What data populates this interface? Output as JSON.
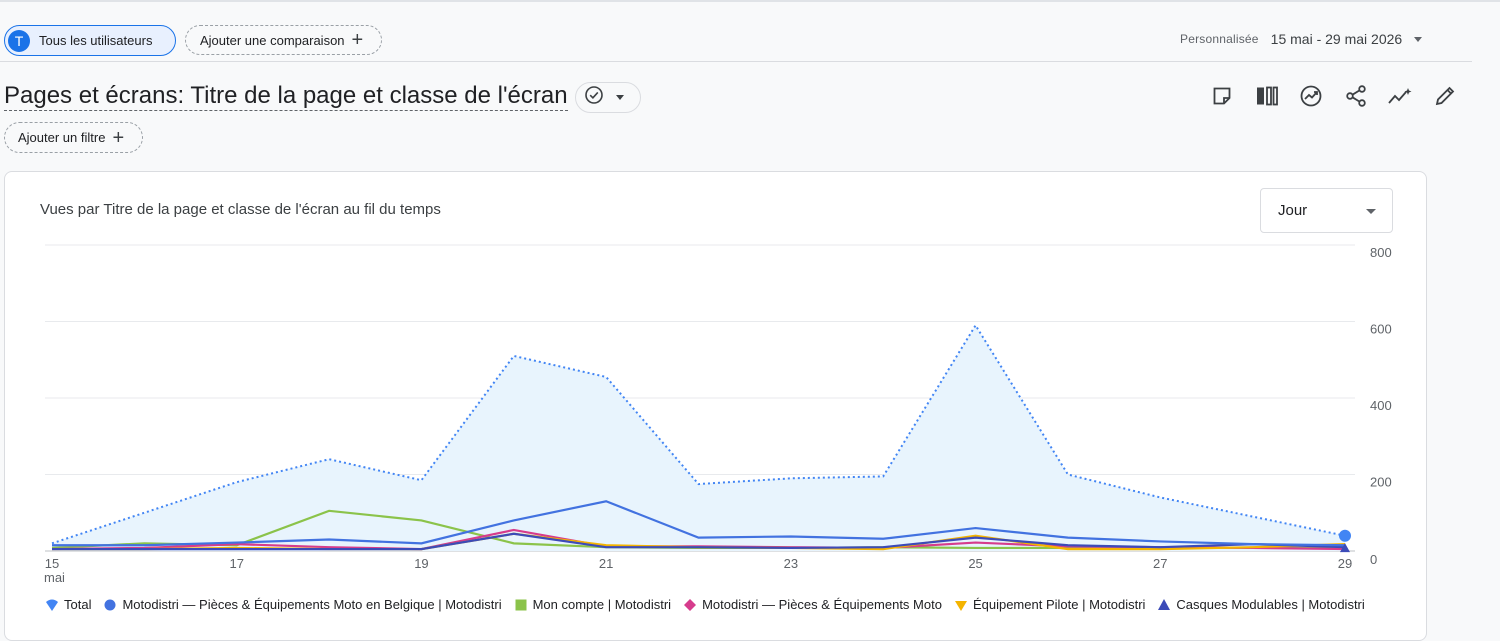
{
  "segment": {
    "avatar_letter": "T",
    "label": "Tous les utilisateurs"
  },
  "comparison": {
    "label": "Ajouter une comparaison"
  },
  "date_range": {
    "label": "Personnalisée",
    "value": "15 mai - 29 mai 2026"
  },
  "page": {
    "title": "Pages et écrans: Titre de la page et classe de l'écran"
  },
  "filter": {
    "label": "Ajouter un filtre"
  },
  "toolbar": {
    "icons": [
      "notes-icon",
      "compare-columns-icon",
      "insights-icon",
      "share-icon",
      "trend-icon",
      "edit-icon"
    ]
  },
  "card": {
    "title": "Vues par Titre de la page et classe de l'écran au fil du temps"
  },
  "granularity": {
    "selected": "Jour"
  },
  "colors": {
    "total": "#4285f4",
    "total_fill": "#e8f4fd",
    "s1": "#4272e0",
    "s2": "#8bc34a",
    "s3": "#d63c8c",
    "s4": "#f4b400",
    "s5": "#3c4bb8"
  },
  "chart_data": {
    "type": "line",
    "title": "Vues par Titre de la page et classe de l'écran au fil du temps",
    "x": [
      "15 mai",
      "16",
      "17",
      "18",
      "19",
      "20",
      "21",
      "22",
      "23",
      "24",
      "25",
      "26",
      "27",
      "28",
      "29"
    ],
    "x_tick_labels": [
      "15",
      "17",
      "19",
      "21",
      "23",
      "25",
      "27",
      "29"
    ],
    "x_first_sublabel": "mai",
    "y_ticks": [
      "0",
      "200",
      "400",
      "600",
      "800"
    ],
    "ylim": [
      0,
      800
    ],
    "y_axis_side": "right",
    "grid": true,
    "legend_position": "bottom",
    "series": [
      {
        "name": "Total",
        "style": "dotted-area",
        "marker": "pin",
        "values": [
          20,
          100,
          180,
          240,
          185,
          510,
          455,
          175,
          190,
          195,
          590,
          200,
          140,
          90,
          40
        ]
      },
      {
        "name": "Motodistri — Pièces & Équipements Moto en Belgique | Motodistri",
        "marker": "circle",
        "values": [
          15,
          15,
          22,
          30,
          20,
          80,
          130,
          35,
          38,
          32,
          60,
          35,
          25,
          18,
          15
        ]
      },
      {
        "name": "Mon compte | Motodistri",
        "marker": "square",
        "values": [
          8,
          20,
          15,
          105,
          80,
          20,
          10,
          8,
          8,
          10,
          8,
          8,
          10,
          8,
          8
        ]
      },
      {
        "name": "Motodistri — Pièces & Équipements Moto",
        "marker": "diamond",
        "values": [
          5,
          8,
          18,
          10,
          5,
          55,
          12,
          12,
          10,
          8,
          22,
          12,
          10,
          8,
          5
        ]
      },
      {
        "name": "Équipement Pilote | Motodistri",
        "marker": "triangle-down",
        "values": [
          5,
          5,
          8,
          5,
          5,
          45,
          15,
          10,
          8,
          5,
          40,
          5,
          5,
          10,
          18
        ]
      },
      {
        "name": "Casques Modulables | Motodistri",
        "marker": "triangle-up",
        "values": [
          5,
          5,
          5,
          5,
          5,
          45,
          10,
          10,
          8,
          10,
          35,
          15,
          10,
          18,
          10
        ]
      }
    ]
  }
}
